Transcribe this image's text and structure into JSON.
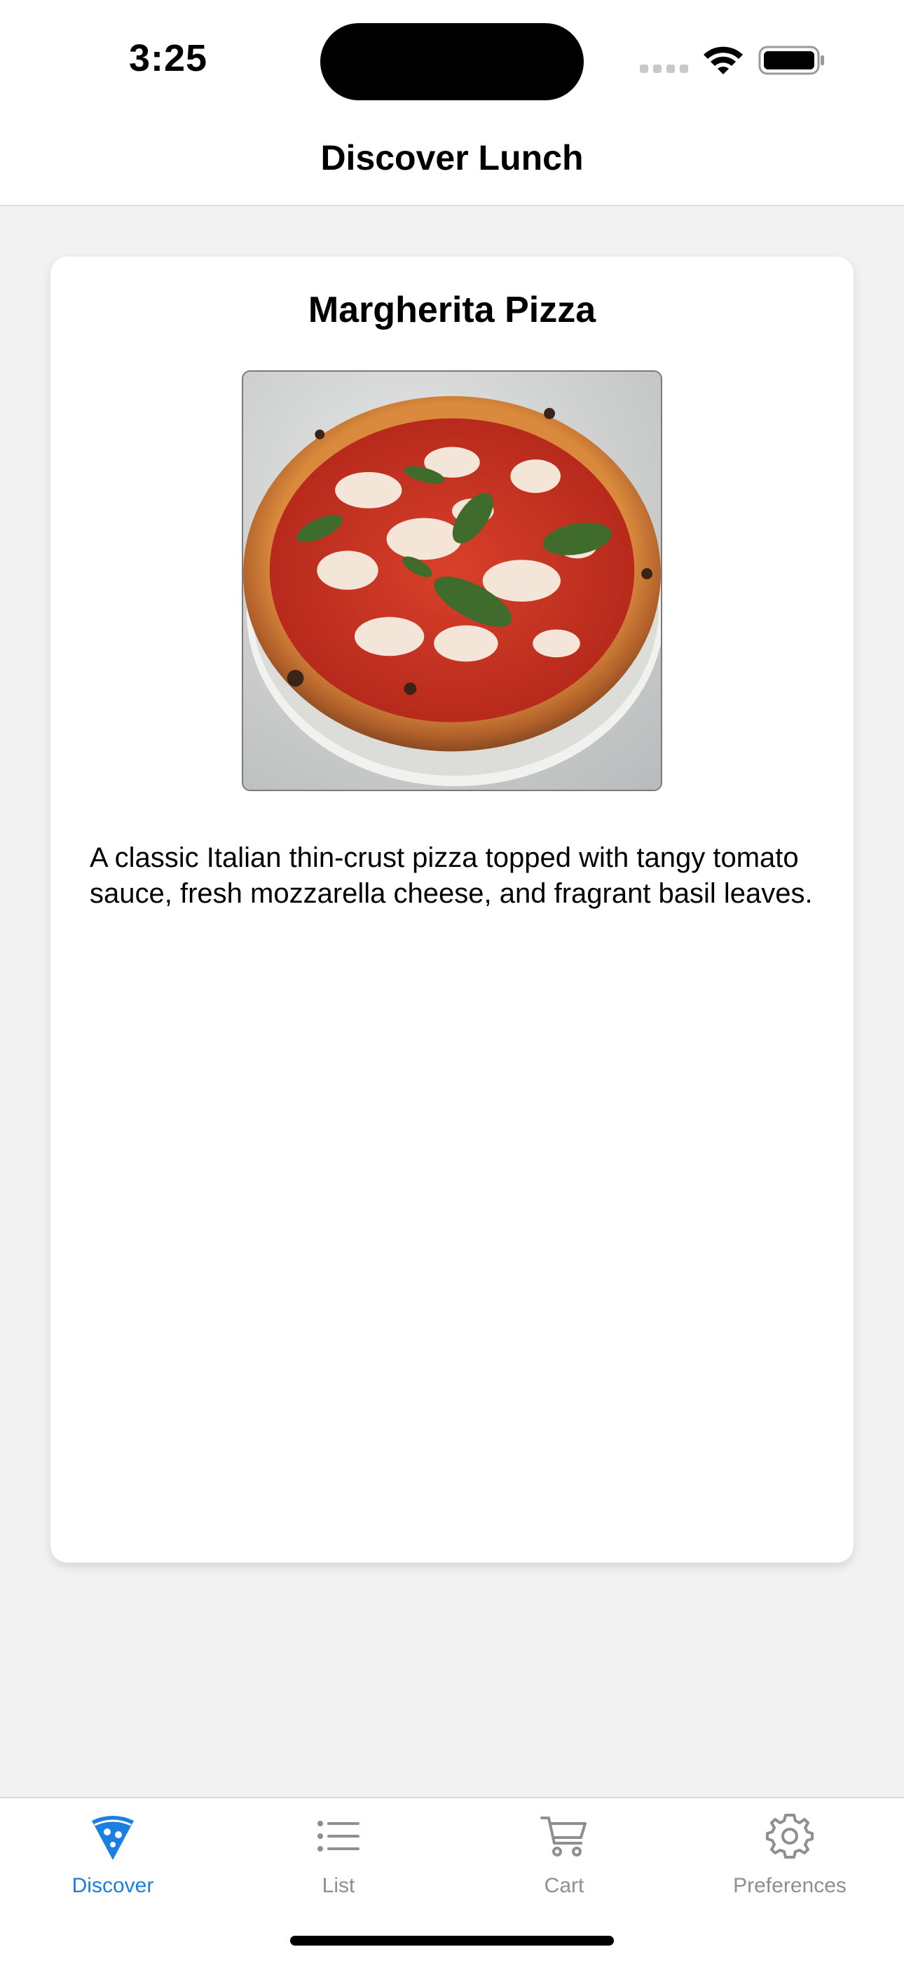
{
  "status_bar": {
    "time": "3:25"
  },
  "nav": {
    "title": "Discover Lunch"
  },
  "card": {
    "title": "Margherita Pizza",
    "image_icon": "pizza-photo",
    "description": "A classic Italian thin-crust pizza topped with tangy tomato sauce, fresh mozzarella cheese, and fragrant basil leaves."
  },
  "tabs": [
    {
      "label": "Discover",
      "icon": "pizza-slice-icon",
      "active": true
    },
    {
      "label": "List",
      "icon": "list-icon",
      "active": false
    },
    {
      "label": "Cart",
      "icon": "cart-icon",
      "active": false
    },
    {
      "label": "Preferences",
      "icon": "gear-icon",
      "active": false
    }
  ],
  "colors": {
    "accent": "#1a7fe0",
    "inactive": "#8e8e93",
    "background": "#f2f2f2",
    "card": "#ffffff"
  }
}
